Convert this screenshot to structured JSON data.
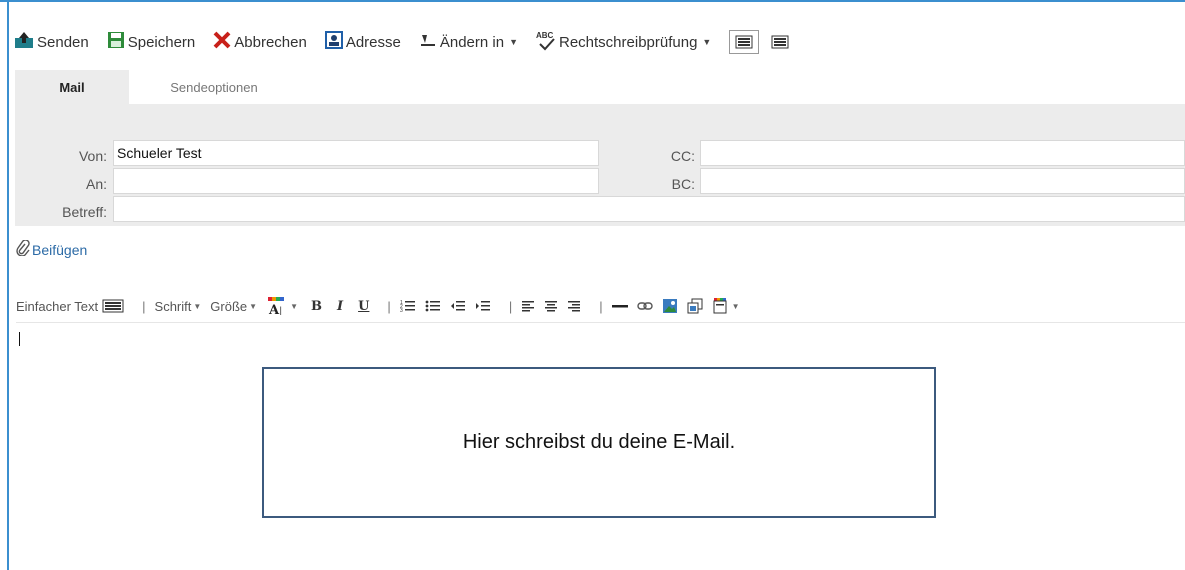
{
  "toolbar": {
    "send": "Senden",
    "save": "Speichern",
    "cancel": "Abbrechen",
    "address": "Adresse",
    "change_to": "Ändern in",
    "spellcheck": "Rechtschreibprüfung",
    "spellcheck_icon_text": "ABC"
  },
  "tabs": [
    {
      "label": "Mail",
      "active": true
    },
    {
      "label": "Sendeoptionen",
      "active": false
    }
  ],
  "fields": {
    "from_label": "Von:",
    "from_value": "Schueler Test",
    "to_label": "An:",
    "to_value": "",
    "subject_label": "Betreff:",
    "subject_value": "",
    "cc_label": "CC:",
    "cc_value": "",
    "bc_label": "BC:",
    "bc_value": ""
  },
  "attach": {
    "label": "Beifügen"
  },
  "format_toolbar": {
    "plain_text": "Einfacher Text",
    "font": "Schrift",
    "size": "Größe",
    "bold": "B",
    "italic": "I",
    "underline": "U"
  },
  "callout": {
    "text": "Hier schreibst du deine E-Mail."
  },
  "colors": {
    "frame": "#3b8fcf",
    "panel": "#ececec",
    "callout_border": "#3c5a7e",
    "link": "#2b6aa6",
    "cancel_red": "#c8201a",
    "save_green": "#2e8b3a"
  }
}
